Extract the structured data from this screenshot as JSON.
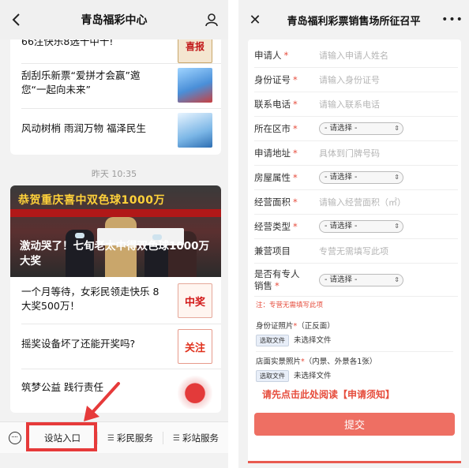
{
  "left": {
    "title": "青岛福彩中心",
    "top_news": [
      {
        "text": "66注快乐8选十中十!",
        "thumb": "喜报"
      },
      {
        "text": "刮刮乐新票“爱拼才会赢”邀您“一起向未来”",
        "thumb": ""
      },
      {
        "text": "风动树梢 雨润万物 福泽民生",
        "thumb": ""
      }
    ],
    "timestamp": "昨天 10:35",
    "banner_head": "恭贺重庆喜中双色球1000万",
    "banner_caption": "激动哭了！七旬老太中得双色球1000万大奖",
    "news": [
      {
        "text": "一个月等待，女彩民领走快乐 8 大奖500万！",
        "thumb": "中奖"
      },
      {
        "text": "摇奖设备坏了还能开奖吗?",
        "thumb": "关注"
      },
      {
        "text": "筑梦公益 践行责任",
        "thumb": ""
      }
    ],
    "nav": {
      "station": "设站入口",
      "service": "彩民服务",
      "shop": "彩站服务"
    }
  },
  "right": {
    "title": "青岛福利彩票销售场所征召平",
    "fields": [
      {
        "label": "申请人",
        "required": "*",
        "placeholder": "请输入申请人姓名",
        "kind": "input"
      },
      {
        "label": "身份证号",
        "required": "*",
        "placeholder": "请输入身份证号",
        "kind": "input"
      },
      {
        "label": "联系电话",
        "required": "*",
        "placeholder": "请输入联系电话",
        "kind": "input"
      },
      {
        "label": "所在区市",
        "required": "*",
        "placeholder": "- 请选择 -",
        "kind": "select"
      },
      {
        "label": "申请地址",
        "required": "*",
        "placeholder": "具体到门牌号码",
        "kind": "input"
      },
      {
        "label": "房屋属性",
        "required": "*",
        "placeholder": "- 请选择 -",
        "kind": "select"
      },
      {
        "label": "经营面积",
        "required": "*",
        "placeholder": "请输入经营面积（㎡）",
        "kind": "input"
      },
      {
        "label": "经营类型",
        "required": "*",
        "placeholder": "- 请选择 -",
        "kind": "select"
      },
      {
        "label": "兼营项目",
        "required": "",
        "placeholder": "专营无需填写此项",
        "kind": "input"
      },
      {
        "label": "是否有专人销售",
        "required": "*",
        "placeholder": "- 请选择 -",
        "kind": "select"
      }
    ],
    "note": "注：专营无需填写此项",
    "id_photo": {
      "label": "身份证照片",
      "required": "*",
      "hint": "（正反面）",
      "button": "选取文件",
      "status": "未选择文件"
    },
    "store_photo": {
      "label": "店面实景照片",
      "required": "*",
      "hint": "（内景、外景各1张）",
      "button": "选取文件",
      "status": "未选择文件"
    },
    "read_link": "请先点击此处阅读【申请须知】",
    "submit": "提交"
  }
}
